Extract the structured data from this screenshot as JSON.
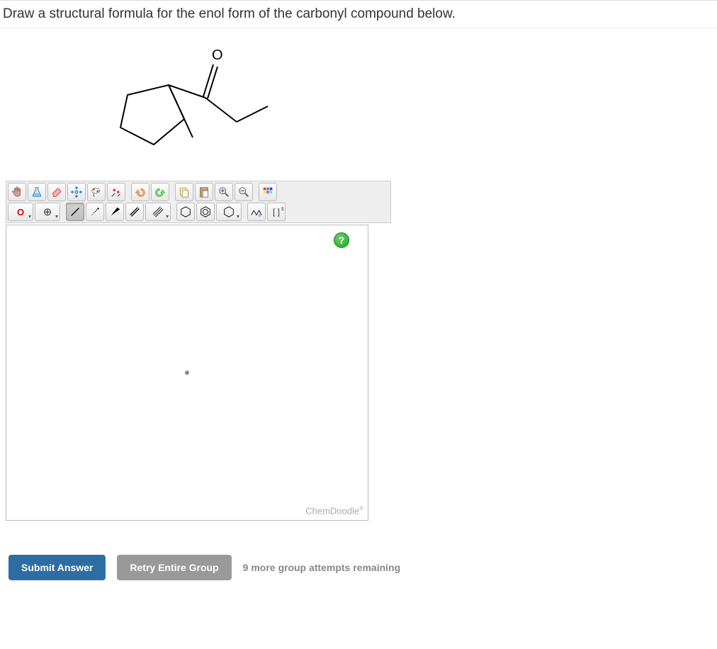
{
  "question": "Draw a structural formula for the enol form of the carbonyl compound below.",
  "structure_label": "O",
  "toolbar": {
    "row1": [
      {
        "name": "hand-icon"
      },
      {
        "name": "flask-icon"
      },
      {
        "name": "eraser-icon"
      },
      {
        "name": "move-icon"
      },
      {
        "name": "lasso-icon"
      },
      {
        "name": "clear-icon"
      },
      {
        "name": "undo-icon"
      },
      {
        "name": "redo-icon"
      },
      {
        "name": "copy-icon"
      },
      {
        "name": "paste-icon"
      },
      {
        "name": "zoom-in-icon"
      },
      {
        "name": "zoom-out-icon"
      },
      {
        "name": "color-icon"
      }
    ],
    "element_label": "O",
    "charge_label": "⊕",
    "bracket_label": "[ ]",
    "charge_sub": "±"
  },
  "canvas": {
    "help": "?",
    "watermark": "ChemDoodle",
    "watermark_reg": "®"
  },
  "buttons": {
    "submit": "Submit Answer",
    "retry": "Retry Entire Group"
  },
  "attempts_text": "9 more group attempts remaining"
}
